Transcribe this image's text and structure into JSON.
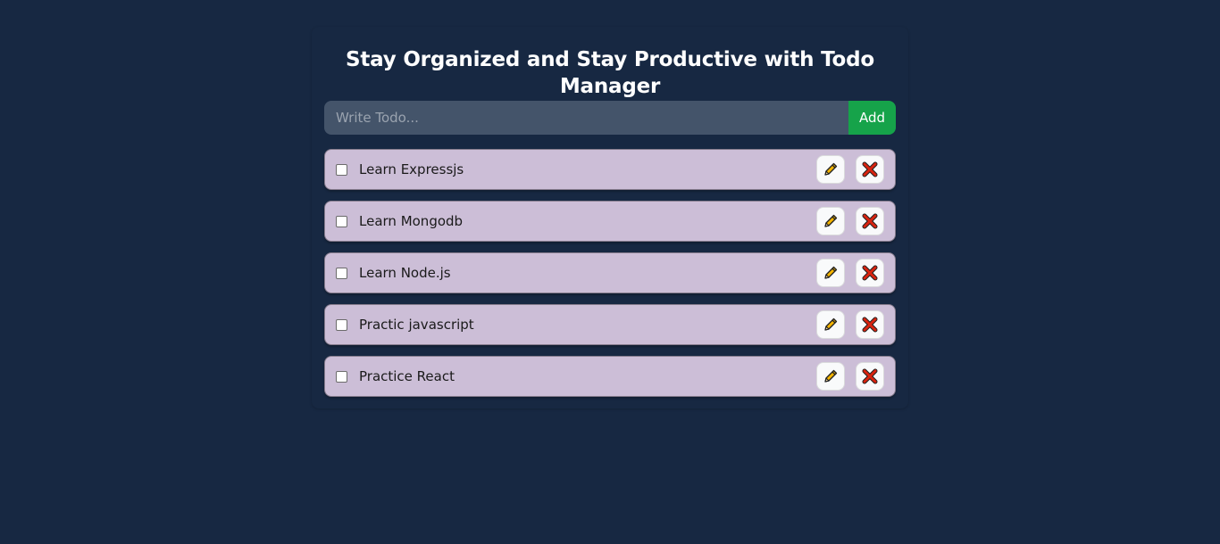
{
  "header": {
    "title": "Stay Organized and Stay Productive with Todo Manager"
  },
  "form": {
    "placeholder": "Write Todo...",
    "value": "",
    "add_label": "Add"
  },
  "todos": [
    {
      "text": "Learn Expressjs",
      "completed": false
    },
    {
      "text": "Learn Mongodb",
      "completed": false
    },
    {
      "text": "Learn Node.js",
      "completed": false
    },
    {
      "text": "Practic javascript",
      "completed": false
    },
    {
      "text": "Practice React",
      "completed": false
    }
  ],
  "icons": {
    "edit": "pencil-icon",
    "delete": "close-icon"
  },
  "colors": {
    "background": "#172842",
    "input": "#44546a",
    "add_button": "#16a34a",
    "todo_item": "#ccbed7"
  }
}
